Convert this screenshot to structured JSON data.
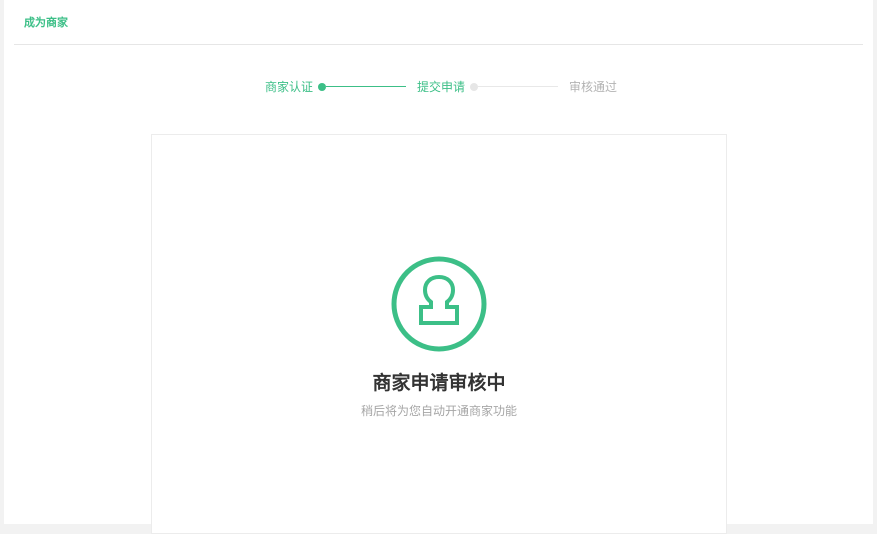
{
  "header": {
    "title": "成为商家"
  },
  "steps": [
    {
      "label": "商家认证",
      "state": "done"
    },
    {
      "label": "提交申请",
      "state": "current"
    },
    {
      "label": "审核通过",
      "state": "pending"
    }
  ],
  "status": {
    "icon": "stamp-icon",
    "title": "商家申请审核中",
    "description": "稍后将为您自动开通商家功能"
  },
  "colors": {
    "accent": "#3cbf87",
    "inactive": "#b3b3b3",
    "title": "#333333"
  }
}
